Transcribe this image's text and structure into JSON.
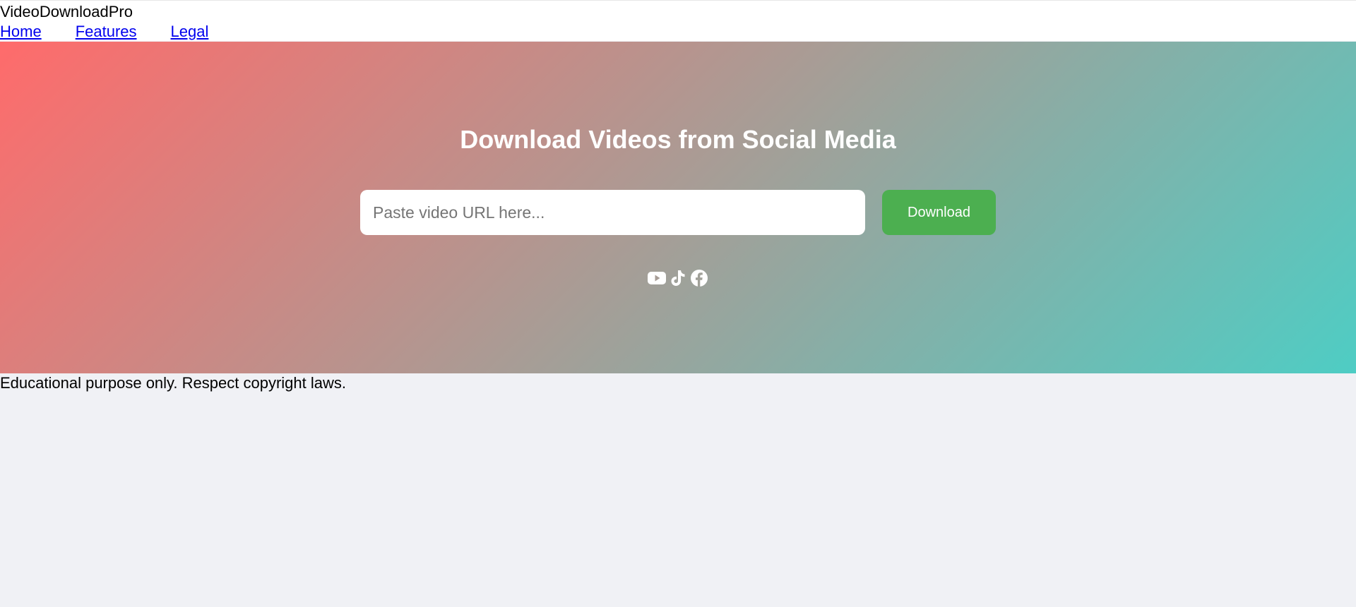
{
  "header": {
    "brand": "VideoDownloadPro",
    "nav": [
      {
        "label": "Home"
      },
      {
        "label": "Features"
      },
      {
        "label": "Legal"
      }
    ]
  },
  "hero": {
    "title": "Download Videos from Social Media",
    "url_input": {
      "value": "",
      "placeholder": "Paste video URL here..."
    },
    "download_label": "Download",
    "platform_icons": [
      "youtube-icon",
      "tiktok-icon",
      "facebook-icon"
    ],
    "gradient_colors": [
      "#ff6b6b",
      "#4ecdc4"
    ],
    "button_color": "#4caf50"
  },
  "footer": {
    "note": "Educational purpose only. Respect copyright laws."
  }
}
